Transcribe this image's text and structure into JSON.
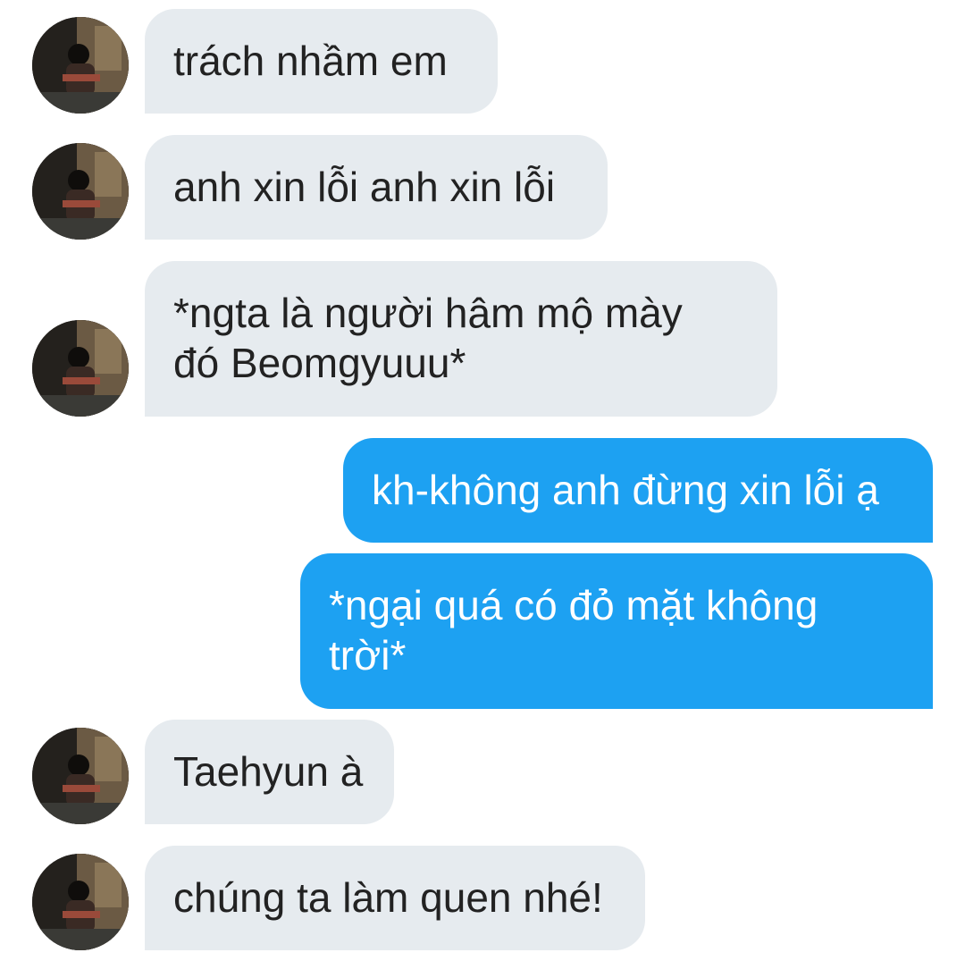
{
  "conversation": {
    "messages": [
      {
        "sender": "other",
        "lines": [
          "trách nhầm em"
        ]
      },
      {
        "sender": "other",
        "lines": [
          "anh xin lỗi anh xin lỗi"
        ]
      },
      {
        "sender": "other",
        "lines": [
          "*ngta là người hâm mộ mày",
          "đó Beomgyuuu*"
        ]
      },
      {
        "sender": "me",
        "lines": [
          "kh-không anh đừng xin lỗi ạ"
        ]
      },
      {
        "sender": "me",
        "lines": [
          "*ngại quá có đỏ mặt không",
          "trời*"
        ]
      },
      {
        "sender": "other",
        "lines": [
          "Taehyun à"
        ]
      },
      {
        "sender": "other",
        "lines": [
          "chúng ta làm quen nhé!"
        ]
      }
    ]
  },
  "colors": {
    "incoming_bubble": "#e6ebef",
    "incoming_text": "#222222",
    "outgoing_bubble": "#1da1f2",
    "outgoing_text": "#ffffff",
    "background": "#ffffff"
  },
  "icons": {
    "avatar": "contact-avatar-photo"
  }
}
